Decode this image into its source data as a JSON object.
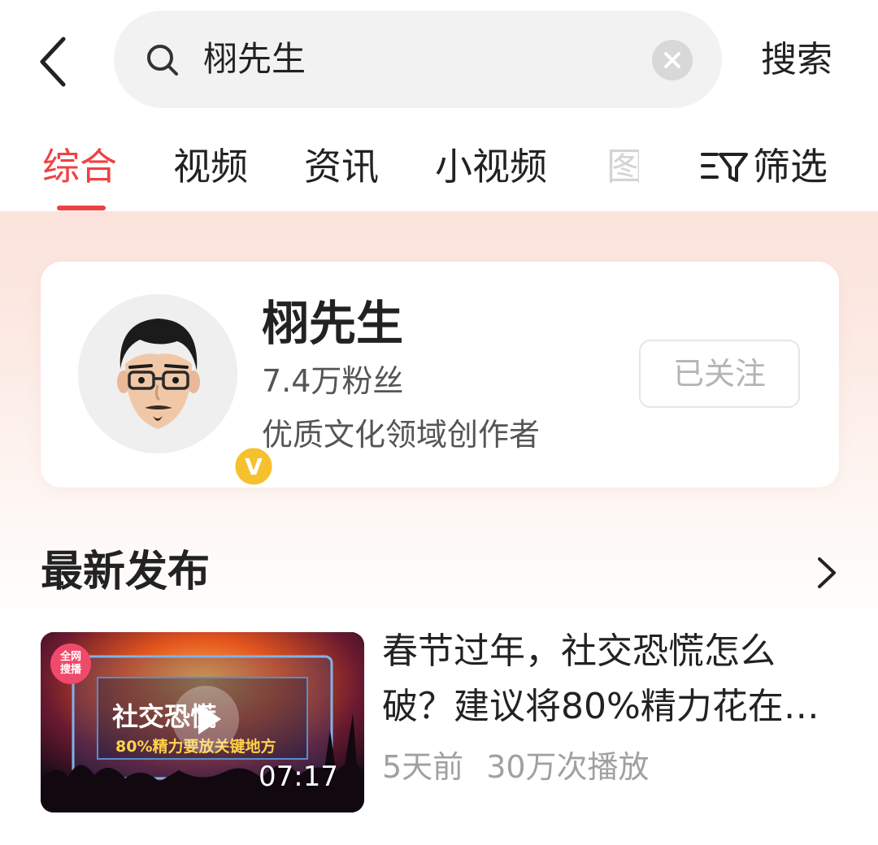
{
  "search": {
    "query": "栩先生",
    "submit_label": "搜索"
  },
  "tabs": [
    {
      "label": "综合",
      "active": true
    },
    {
      "label": "视频",
      "active": false
    },
    {
      "label": "资讯",
      "active": false
    },
    {
      "label": "小视频",
      "active": false
    },
    {
      "label": "图",
      "active": false
    }
  ],
  "filter": {
    "label": "筛选"
  },
  "profile": {
    "name": "栩先生",
    "fans": "7.4万粉丝",
    "description": "优质文化领域创作者",
    "verified_badge": "V",
    "follow_label": "已关注"
  },
  "section": {
    "title": "最新发布"
  },
  "video": {
    "title_line1": "春节过年，社交恐慌怎么",
    "title_line2": "破？建议将80%精力花在…",
    "thumb_title": "社交恐慌",
    "thumb_subtitle": "80%精力要放关键地方",
    "thumb_badge": "全网\n搜播",
    "duration": "07:17",
    "time_ago": "5天前",
    "plays": "30万次播放"
  },
  "colors": {
    "accent": "#f04142",
    "badge_gold": "#f5c12e"
  },
  "icons": {
    "back": "chevron-left-icon",
    "search": "search-icon",
    "clear": "clear-icon",
    "filter": "filter-icon",
    "more": "chevron-right-icon",
    "play": "play-icon"
  }
}
